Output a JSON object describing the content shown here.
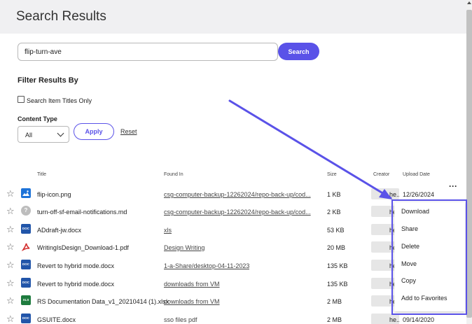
{
  "header": {
    "title": "Search Results"
  },
  "search": {
    "value": "flip-turn-ave",
    "button_label": "Search"
  },
  "filters": {
    "heading": "Filter Results By",
    "titles_only_label": "Search Item Titles Only",
    "content_type_label": "Content Type",
    "content_type_value": "All",
    "apply_label": "Apply",
    "reset_label": "Reset"
  },
  "table": {
    "columns": {
      "title": "Title",
      "found_in": "Found In",
      "size": "Size",
      "creator": "Creator",
      "upload_date": "Upload Date"
    },
    "rows": [
      {
        "icon": "image-file-icon",
        "title": "flip-icon.png",
        "found_in": "csg-computer-backup-12262024/repo-back-up/cod...",
        "size": "1 KB",
        "creator": "he...",
        "date": "12/26/2024"
      },
      {
        "icon": "markdown-file-icon",
        "title": "turn-off-sf-email-notifications.md",
        "found_in": "csg-computer-backup-12262024/repo-back-up/cod...",
        "size": "2 KB",
        "creator": "he...",
        "date": ""
      },
      {
        "icon": "word-doc-icon",
        "title": "ADdraft-jw.docx",
        "found_in": "xls",
        "size": "53 KB",
        "creator": "he...",
        "date": ""
      },
      {
        "icon": "pdf-file-icon",
        "title": "WritingIsDesign_Download-1.pdf",
        "found_in": "Design Writing",
        "size": "20 MB",
        "creator": "he...",
        "date": ""
      },
      {
        "icon": "word-doc-icon",
        "title": "Revert to hybrid mode.docx",
        "found_in": "1-a-Share/desktop-04-11-2023",
        "size": "135 KB",
        "creator": "he...",
        "date": ""
      },
      {
        "icon": "word-doc-icon",
        "title": "Revert to hybrid mode.docx",
        "found_in": "downloads from VM",
        "size": "135 KB",
        "creator": "he...",
        "date": ""
      },
      {
        "icon": "excel-file-icon",
        "title": "RS Documentation Data_v1_20210414 (1).xlsx",
        "found_in": "downloads from VM",
        "size": "2 MB",
        "creator": "he...",
        "date": ""
      },
      {
        "icon": "word-doc-icon",
        "title": "GSUITE.docx",
        "found_in": "sso files pdf",
        "size": "2 MB",
        "creator": "he...",
        "date": "09/14/2020"
      }
    ]
  },
  "context_menu": {
    "items": [
      "Download",
      "Share",
      "Delete",
      "Move",
      "Copy",
      "Add to Favorites"
    ]
  },
  "icon_labels": {
    "doc": "DOC",
    "xls": "XLS",
    "md": "?"
  },
  "colors": {
    "accent": "#5a52e8",
    "header_bg": "#f0f0f2"
  }
}
